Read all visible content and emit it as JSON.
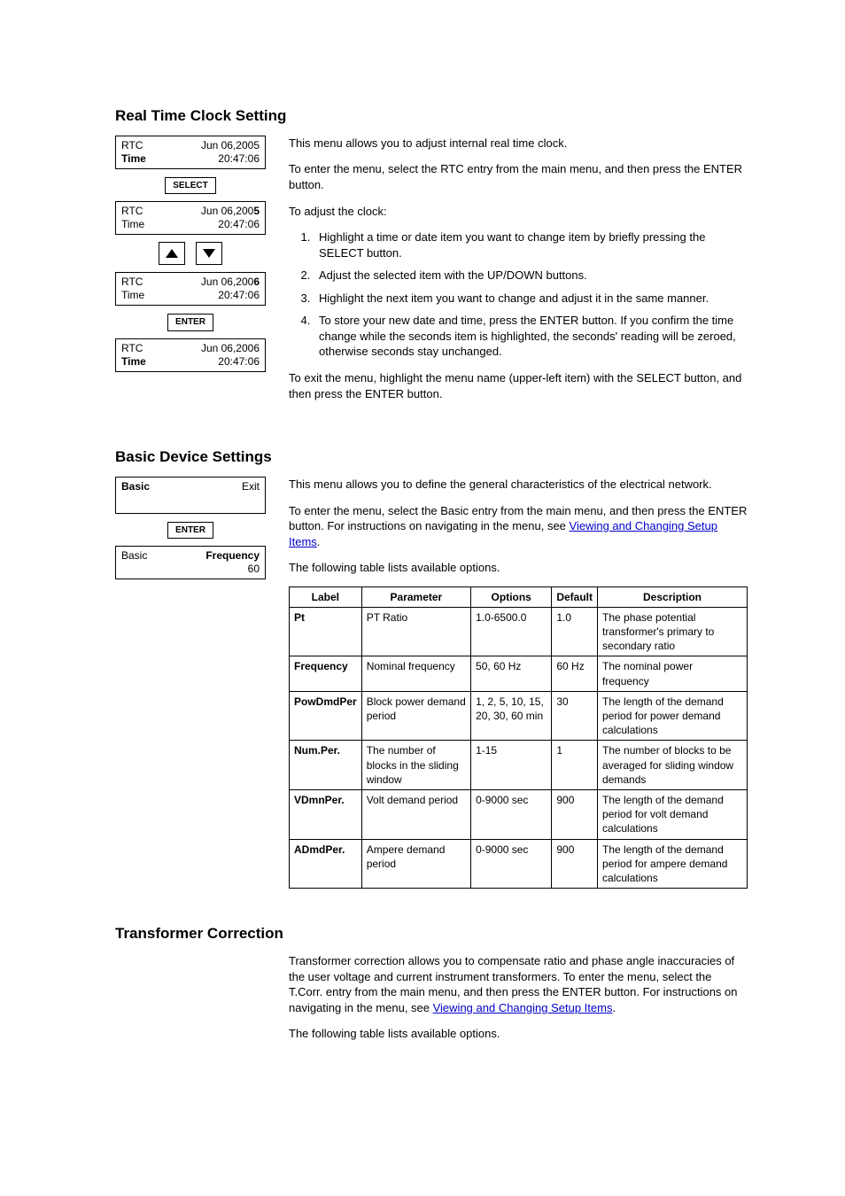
{
  "rtc": {
    "heading": "Real Time Clock Setting",
    "intro": "This menu allows you to adjust internal real time clock.",
    "enter_text": "To enter the menu, select the RTC entry from the main menu, and then press the ENTER button.",
    "adjust_label": "To adjust the clock:",
    "steps": [
      "Highlight a time or date item you want to change item by briefly pressing the SELECT button.",
      "Adjust the selected item with the UP/DOWN buttons.",
      "Highlight the next item you want to change and adjust it in the same manner.",
      "To store your new date and time, press the ENTER button. If you confirm the time change while the seconds item is highlighted, the seconds' reading will be zeroed, otherwise seconds stay unchanged."
    ],
    "exit_text": "To exit the menu, highlight the menu name (upper-left item) with the SELECT button, and then press the ENTER button.",
    "screens": {
      "s1": {
        "l1a": "RTC",
        "l1b": "Jun 06,2005",
        "l2a": "Time",
        "l2b": "20:47:06"
      },
      "select_btn": "SELECT",
      "s2": {
        "l1a": "RTC",
        "l1b_pre": "Jun 06,200",
        "l1b_bold": "5",
        "l2a": "Time",
        "l2b": "20:47:06"
      },
      "s3": {
        "l1a": "RTC",
        "l1b_pre": "Jun 06,200",
        "l1b_bold": "6",
        "l2a": "Time",
        "l2b": "20:47:06"
      },
      "enter_btn": "ENTER",
      "s4": {
        "l1a": "RTC",
        "l1b": "Jun 06,2006",
        "l2a": "Time",
        "l2b": "20:47:06"
      }
    }
  },
  "basic": {
    "heading": "Basic Device Settings",
    "intro": "This menu allows you to define the general characteristics of the electrical network.",
    "enter_text_pre": "To enter the menu, select the Basic entry from the main menu, and then press the ENTER button. For instructions on navigating in the menu, see ",
    "enter_link": "Viewing and Changing Setup Items",
    "enter_text_post": ".",
    "table_intro": "The following table lists available options.",
    "screens": {
      "s1": {
        "l1a": "Basic",
        "l1b": "Exit"
      },
      "enter_btn": "ENTER",
      "s2": {
        "l1a": "Basic",
        "l1b": "Frequency",
        "l2b": "60"
      }
    },
    "table": {
      "headers": [
        "Label",
        "Parameter",
        "Options",
        "Default",
        "Description"
      ],
      "rows": [
        {
          "label": "Pt",
          "param": "PT Ratio",
          "options": "1.0-6500.0",
          "default": "1.0",
          "desc": "The phase potential transformer's primary to secondary ratio"
        },
        {
          "label": "Frequency",
          "param": "Nominal frequency",
          "options": "50, 60 Hz",
          "default": "60 Hz",
          "desc": "The nominal power frequency"
        },
        {
          "label": "PowDmdPer",
          "param": "Block power demand period",
          "options": "1, 2, 5, 10, 15, 20, 30, 60 min",
          "default": "30",
          "desc": "The length of the demand period for power demand calculations"
        },
        {
          "label": "Num.Per.",
          "param": "The number of blocks in the sliding window",
          "options": "1-15",
          "default": "1",
          "desc": "The number of blocks to be averaged for sliding window demands"
        },
        {
          "label": "VDmnPer.",
          "param": "Volt demand period",
          "options": "0-9000 sec",
          "default": "900",
          "desc": "The length of the demand period for volt demand calculations"
        },
        {
          "label": "ADmdPer.",
          "param": "Ampere demand period",
          "options": "0-9000 sec",
          "default": "900",
          "desc": "The length of the demand period for ampere demand calculations"
        }
      ]
    }
  },
  "tcorr": {
    "heading": "Transformer Correction",
    "p1_pre": "Transformer correction allows you to compensate ratio and phase angle inaccuracies of the user voltage and current instrument transformers. To enter the menu, select the T.Corr. entry from the main menu, and then press the ENTER button. For instructions on navigating in the menu, see ",
    "p1_link": "Viewing and Changing Setup Items",
    "p1_post": ".",
    "p2": "The following table lists available options."
  }
}
